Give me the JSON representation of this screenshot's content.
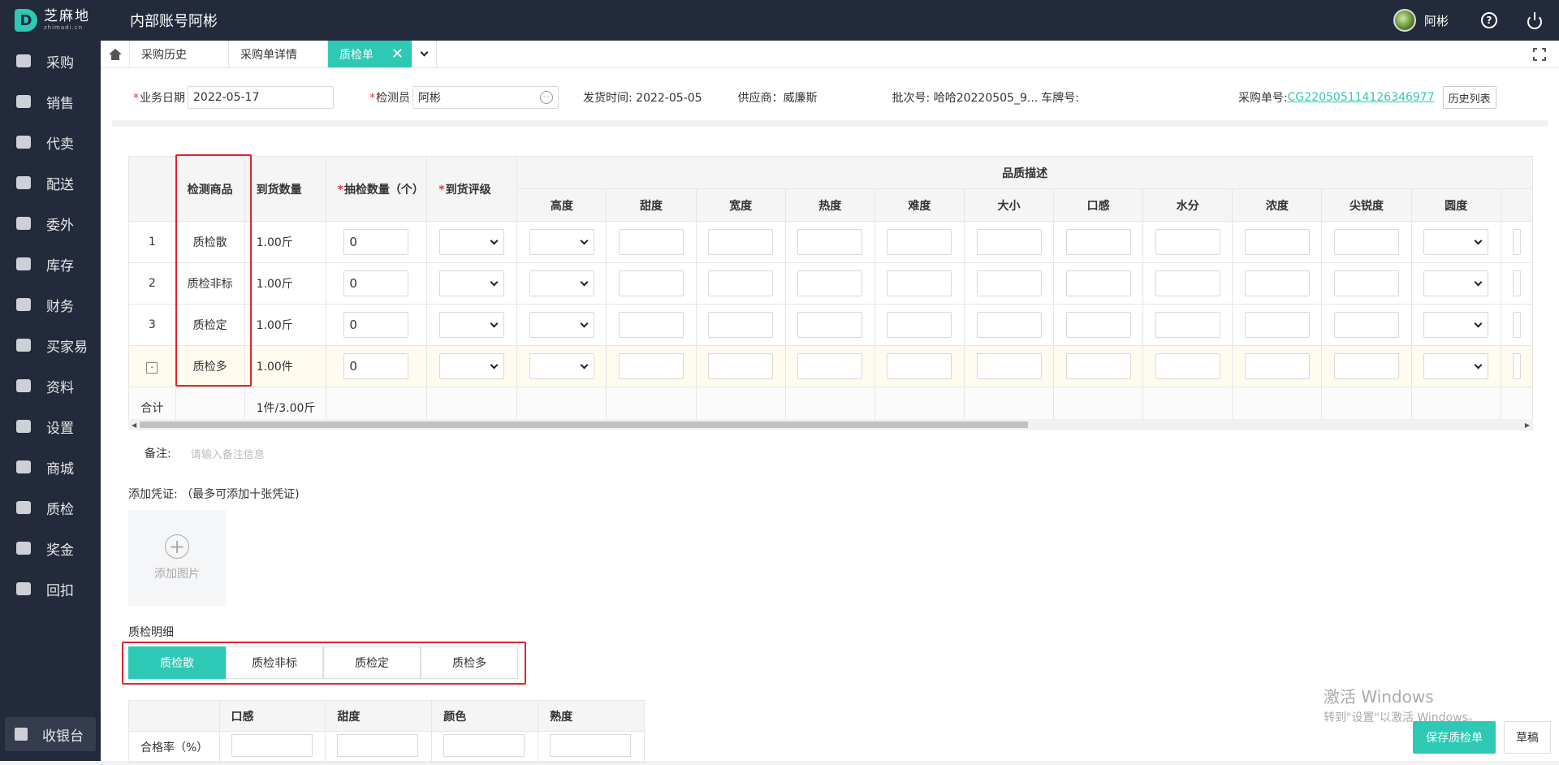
{
  "brand": {
    "logo_letter": "D",
    "name": "芝麻地",
    "sub": "zhimadi.cn"
  },
  "header": {
    "account_title": "内部账号阿彬",
    "username": "阿彬",
    "help_symbol": "?"
  },
  "sidebar": {
    "items": [
      {
        "label": "采购",
        "icon": "basket-icon"
      },
      {
        "label": "销售",
        "icon": "cart-icon"
      },
      {
        "label": "代卖",
        "icon": "tag-icon"
      },
      {
        "label": "配送",
        "icon": "truck-icon"
      },
      {
        "label": "委外",
        "icon": "building-icon"
      },
      {
        "label": "库存",
        "icon": "warehouse-icon"
      },
      {
        "label": "财务",
        "icon": "yen-icon"
      },
      {
        "label": "买家易",
        "icon": "store-icon"
      },
      {
        "label": "资料",
        "icon": "printer-icon"
      },
      {
        "label": "设置",
        "icon": "gear-icon"
      },
      {
        "label": "商城",
        "icon": "shop-icon"
      },
      {
        "label": "质检",
        "icon": "basket-icon"
      },
      {
        "label": "奖金",
        "icon": "store-icon"
      },
      {
        "label": "回扣",
        "icon": "building-icon"
      }
    ],
    "bottom": {
      "label": "收银台",
      "icon": "cashier-icon"
    }
  },
  "tabs": [
    {
      "label": "采购历史"
    },
    {
      "label": "采购单详情"
    },
    {
      "label": "质检单",
      "close": "✕"
    }
  ],
  "info": {
    "date_label": "业务日期",
    "date_value": "2022-05-17",
    "inspector_label": "检测员",
    "inspector_value": "阿彬",
    "ship_time": "发货时间: 2022-05-05",
    "supplier": "供应商：威廉斯",
    "batch": "批次号: 哈哈20220505_9...",
    "plate": "车牌号:",
    "order_label": "采购单号:",
    "order_no": "CG220505114126346977",
    "history_btn": "历史列表"
  },
  "grid": {
    "headers": {
      "product": "检测商品",
      "arrival_qty": "到货数量",
      "sample_qty": "抽检数量（个）",
      "grade": "到货评级",
      "quality": "品质描述"
    },
    "quality_cols": [
      "高度",
      "甜度",
      "宽度",
      "热度",
      "难度",
      "大小",
      "口感",
      "水分",
      "浓度",
      "尖锐度",
      "圆度"
    ],
    "rows": [
      {
        "no": "1",
        "product": "质检散",
        "arrival": "1.00斤",
        "sample": "0"
      },
      {
        "no": "2",
        "product": "质检非标",
        "arrival": "1.00斤",
        "sample": "0"
      },
      {
        "no": "3",
        "product": "质检定",
        "arrival": "1.00斤",
        "sample": "0"
      },
      {
        "no": "-",
        "product": "质检多",
        "arrival": "1.00件",
        "sample": "0"
      }
    ],
    "total_label": "合计",
    "total_value": "1件/3.00斤"
  },
  "remark": {
    "label": "备注:",
    "placeholder": "请输入备注信息"
  },
  "voucher": {
    "label": "添加凭证: （最多可添加十张凭证)",
    "upload": "添加图片"
  },
  "detail": {
    "label": "质检明细",
    "tabs": [
      "质检散",
      "质检非标",
      "质检定",
      "质检多"
    ],
    "cols": [
      "口感",
      "甜度",
      "颜色",
      "熟度"
    ],
    "row_label": "合格率（%）"
  },
  "watermark": {
    "line1": "激活 Windows",
    "line2": "转到\"设置\"以激活 Windows。"
  },
  "actions": {
    "save": "保存质检单",
    "draft": "草稿"
  },
  "colors": {
    "accent": "#2ec9b4",
    "nav_bg": "#222a3b",
    "highlight": "#e0242e"
  }
}
